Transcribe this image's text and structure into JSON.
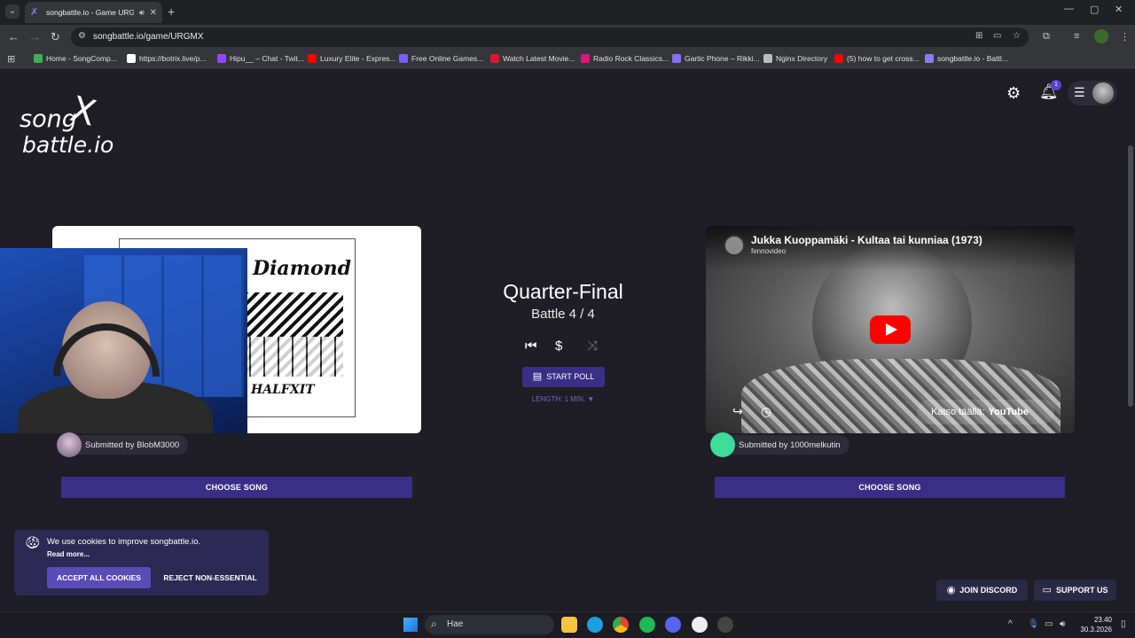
{
  "browser": {
    "tab_title": "songbattle.io - Game URGMX",
    "url": "songbattle.io/game/URGMX",
    "bookmarks": [
      {
        "label": "Home - SongComp...",
        "color": "#3fae5b"
      },
      {
        "label": "https://botrix.live/p...",
        "color": "#ffffff"
      },
      {
        "label": "Hipu__ – Chat - Twit...",
        "color": "#9146ff"
      },
      {
        "label": "Luxury Elite - Expres...",
        "color": "#ff0000"
      },
      {
        "label": "Free Online Games...",
        "color": "#7a5cff"
      },
      {
        "label": "Watch Latest Movie...",
        "color": "#e0152d"
      },
      {
        "label": "Radio Rock Classics...",
        "color": "#e0147a"
      },
      {
        "label": "Gartic Phone – Rikki...",
        "color": "#8a6df5"
      },
      {
        "label": "Nginx Directory",
        "color": "#bbbbbb"
      },
      {
        "label": "(5) how to get cross...",
        "color": "#ff0000"
      },
      {
        "label": "songbattle.io - Battl...",
        "color": "#8d7cf0"
      }
    ]
  },
  "site": {
    "logo_line1": "song",
    "logo_line2": "battle.io",
    "notification_count": "1"
  },
  "left": {
    "album_title": "Diamond",
    "album_subtitle": "HALFXIT",
    "submitted_by": "Submitted by BlobM3000",
    "choose_label": "CHOOSE SONG"
  },
  "center": {
    "stage": "Quarter-Final",
    "battle": "Battle 4 / 4",
    "start_poll": "START POLL",
    "length": "LENGTH: 1 MIN. ▼"
  },
  "right": {
    "video_title": "Jukka Kuoppamäki - Kultaa tai kunniaa (1973)",
    "channel": "fennovideo",
    "watch_on": "Katso täällä:",
    "youtube": "YouTube",
    "submitted_by": "Submitted by 1000melkutin",
    "choose_label": "CHOOSE SONG"
  },
  "cookie": {
    "message": "We use cookies to improve songbattle.io.",
    "read_more": "Read more...",
    "accept": "ACCEPT ALL COOKIES",
    "reject": "REJECT NON-ESSENTIAL"
  },
  "footer": {
    "discord": "JOIN DISCORD",
    "support": "SUPPORT US"
  },
  "taskbar": {
    "search_text": "Hae",
    "time": "23.40",
    "date": "30.3.2026"
  },
  "colors": {
    "accent": "#3a2f86",
    "background": "#1f1e26"
  }
}
